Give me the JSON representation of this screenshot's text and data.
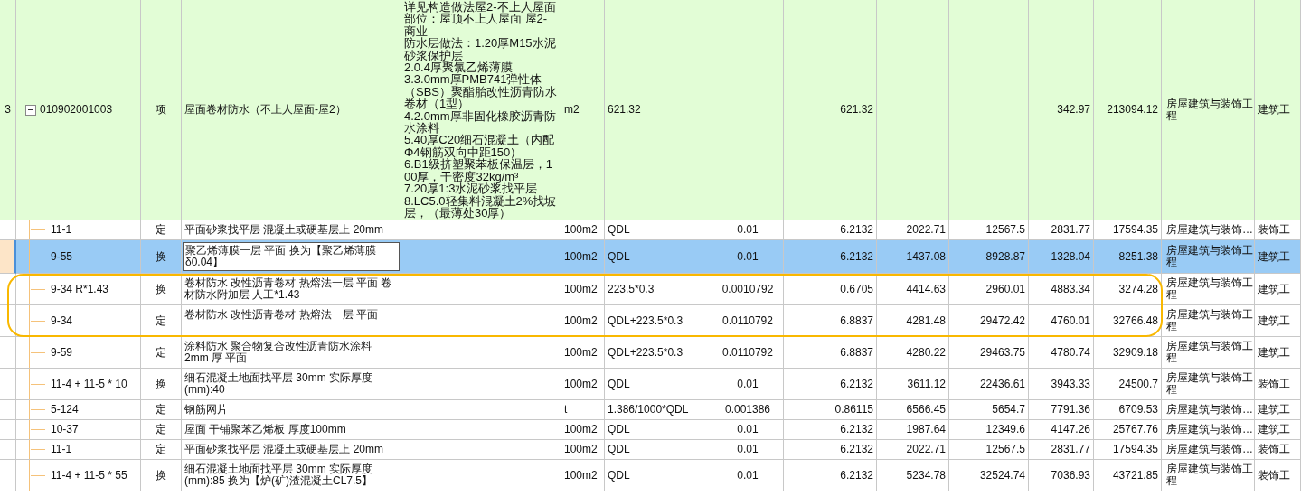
{
  "rows": [
    {
      "column_1": "3",
      "column_2": "010902001003",
      "expanded": true,
      "column_3": "项",
      "column_4": "屋面卷材防水（不上人屋面-屋2）",
      "column_5": [
        "详见构造做法屋2-不上人屋面",
        "部位：屋顶不上人屋面 屋2-商业",
        "防水层做法：1.20厚M15水泥砂浆保护层",
        "2.0.4厚聚氯乙烯薄膜",
        "3.3.0mm厚PMB741弹性体（SBS）聚酯胎改性沥青防水卷材（1型）",
        "4.2.0mm厚非固化橡胶沥青防水涂料",
        "5.40厚C20细石混凝土（内配Φ4钢筋双向中距150）",
        "6.B1级挤塑聚苯板保温层，100厚，干密度32kg/m³",
        "7.20厚1:3水泥砂浆找平层",
        "8.LC5.0轻集料混凝土2%找坡层，（最薄处30厚）"
      ],
      "column_6": "m2",
      "column_7": "621.32",
      "column_9": "621.32",
      "column_12": "342.97",
      "column_13": "213094.12",
      "column_14": "房屋建筑与装饰工程",
      "column_15": "建筑工",
      "children": [
        {
          "selected": false,
          "column_2": "11-1",
          "column_3": "定",
          "column_4": "平面砂浆找平层 混凝土或硬基层上 20mm",
          "column_6": "100m2",
          "column_7": "QDL",
          "column_8": "0.01",
          "column_9": "6.2132",
          "column_10": "2022.71",
          "column_11": "12567.5",
          "column_12": "2831.77",
          "column_13": "17594.35",
          "column_14": "房屋建筑与装饰…",
          "column_15": "装饰工"
        },
        {
          "selected": true,
          "column_2": "9-55",
          "column_3": "换",
          "column_4": "聚乙烯薄膜一层 平面  换为【聚乙烯薄膜δ0.04】",
          "column_6": "100m2",
          "column_7": "QDL",
          "column_8": "0.01",
          "column_9": "6.2132",
          "column_10": "1437.08",
          "column_11": "8928.87",
          "column_12": "1328.04",
          "column_13": "8251.38",
          "column_14": "房屋建筑与装饰工程",
          "column_15": "建筑工"
        },
        {
          "selected": false,
          "circled": true,
          "column_2": "9-34 R*1.43",
          "column_3": "换",
          "column_4": "卷材防水 改性沥青卷材 热熔法一层 平面 卷材防水附加层 人工*1.43",
          "column_6": "100m2",
          "column_7": "223.5*0.3",
          "column_8": "0.0010792",
          "column_9": "0.6705",
          "column_10": "4414.63",
          "column_11": "2960.01",
          "column_12": "4883.34",
          "column_13": "3274.28",
          "column_14": "房屋建筑与装饰工程",
          "column_15": "建筑工"
        },
        {
          "selected": false,
          "circled": true,
          "column_2": "9-34",
          "column_3": "定",
          "column_4": "卷材防水 改性沥青卷材 热熔法一层 平面",
          "column_6": "100m2",
          "column_7": "QDL+223.5*0.3",
          "column_8": "0.0110792",
          "column_9": "6.8837",
          "column_10": "4281.48",
          "column_11": "29472.42",
          "column_12": "4760.01",
          "column_13": "32766.48",
          "column_14": "房屋建筑与装饰工程",
          "column_15": "建筑工"
        },
        {
          "selected": false,
          "column_2": "9-59",
          "column_3": "定",
          "column_4": "涂料防水 聚合物复合改性沥青防水涂料 2mm 厚 平面",
          "column_6": "100m2",
          "column_7": "QDL+223.5*0.3",
          "column_8": "0.0110792",
          "column_9": "6.8837",
          "column_10": "4280.22",
          "column_11": "29463.75",
          "column_12": "4780.74",
          "column_13": "32909.18",
          "column_14": "房屋建筑与装饰工程",
          "column_15": "建筑工"
        },
        {
          "selected": false,
          "column_2": "11-4 + 11-5 * 10",
          "column_3": "换",
          "column_4": "细石混凝土地面找平层 30mm  实际厚度(mm):40",
          "column_6": "100m2",
          "column_7": "QDL",
          "column_8": "0.01",
          "column_9": "6.2132",
          "column_10": "3611.12",
          "column_11": "22436.61",
          "column_12": "3943.33",
          "column_13": "24500.7",
          "column_14": "房屋建筑与装饰工程",
          "column_15": "装饰工"
        },
        {
          "selected": false,
          "column_2": "5-124",
          "column_3": "定",
          "column_4": "钢筋网片",
          "column_6": "t",
          "column_7": "1.386/1000*QDL",
          "column_8": "0.001386",
          "column_9": "0.86115",
          "column_10": "6566.45",
          "column_11": "5654.7",
          "column_12": "7791.36",
          "column_13": "6709.53",
          "column_14": "房屋建筑与装饰…",
          "column_15": "建筑工"
        },
        {
          "selected": false,
          "column_2": "10-37",
          "column_3": "定",
          "column_4": "屋面 干铺聚苯乙烯板 厚度100mm",
          "column_6": "100m2",
          "column_7": "QDL",
          "column_8": "0.01",
          "column_9": "6.2132",
          "column_10": "1987.64",
          "column_11": "12349.6",
          "column_12": "4147.26",
          "column_13": "25767.76",
          "column_14": "房屋建筑与装饰…",
          "column_15": "建筑工"
        },
        {
          "selected": false,
          "column_2": "11-1",
          "column_3": "定",
          "column_4": "平面砂浆找平层 混凝土或硬基层上 20mm",
          "column_6": "100m2",
          "column_7": "QDL",
          "column_8": "0.01",
          "column_9": "6.2132",
          "column_10": "2022.71",
          "column_11": "12567.5",
          "column_12": "2831.77",
          "column_13": "17594.35",
          "column_14": "房屋建筑与装饰…",
          "column_15": "装饰工"
        },
        {
          "selected": false,
          "column_2": "11-4 + 11-5 * 55",
          "column_3": "换",
          "column_4": "细石混凝土地面找平层 30mm  实际厚度(mm):85  换为【炉(矿)渣混凝土CL7.5】",
          "column_6": "100m2",
          "column_7": "QDL",
          "column_8": "0.01",
          "column_9": "6.2132",
          "column_10": "5234.78",
          "column_11": "32524.74",
          "column_12": "7036.93",
          "column_13": "43721.85",
          "column_14": "房屋建筑与装饰工程",
          "column_15": "装饰工"
        }
      ]
    }
  ]
}
